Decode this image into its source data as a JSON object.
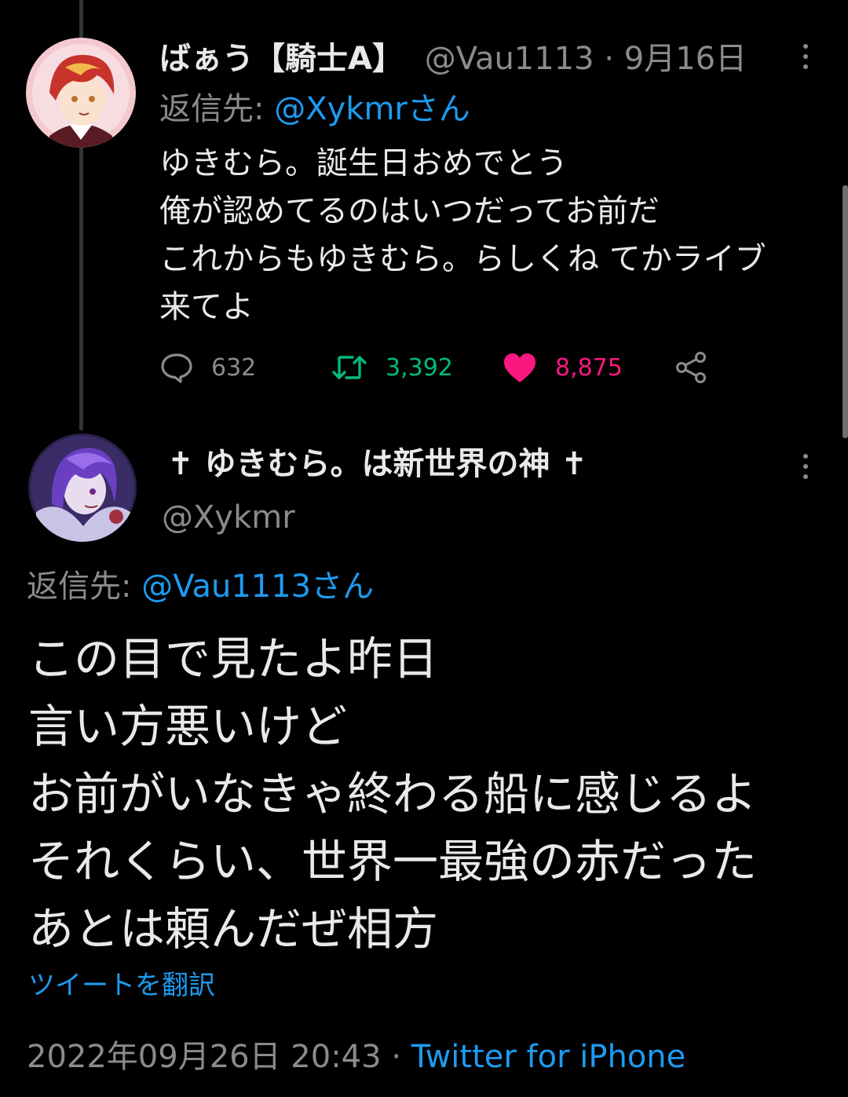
{
  "tweet1": {
    "display_name": "ばぁう【騎士A】",
    "handle": "@Vau1113",
    "separator": "·",
    "date": "9月16日",
    "reply_prefix": "返信先:",
    "reply_to": "@Xykmrさん",
    "lines": [
      "ゆきむら。誕生日おめでとう",
      "俺が認めてるのはいつだってお前だ",
      "これからもゆきむら。らしくね てかライブ",
      "来てよ"
    ],
    "reply_count": "632",
    "retweet_count": "3,392",
    "like_count": "8,875"
  },
  "tweet2": {
    "display_name": "✝ ゆきむら。は新世界の神 ✝",
    "handle": "@Xykmr",
    "reply_prefix": "返信先:",
    "reply_to": "@Vau1113さん",
    "lines": [
      "この目で見たよ昨日",
      "言い方悪いけど",
      "お前がいなきゃ終わる船に感じるよ",
      "それくらい、世界一最強の赤だった",
      "あとは頼んだぜ相方"
    ],
    "translate_label": "ツイートを翻訳",
    "timestamp": "2022年09月26日 20:43",
    "separator": "·",
    "source": "Twitter for iPhone"
  },
  "colors": {
    "background": "#000000",
    "text": "#e7e9ea",
    "muted": "#8b8b8b",
    "link": "#1d9bf0",
    "retweet": "#00ba7c",
    "like": "#f91880"
  },
  "icons": [
    "reply-icon",
    "retweet-icon",
    "heart-icon",
    "share-icon",
    "more-icon"
  ]
}
